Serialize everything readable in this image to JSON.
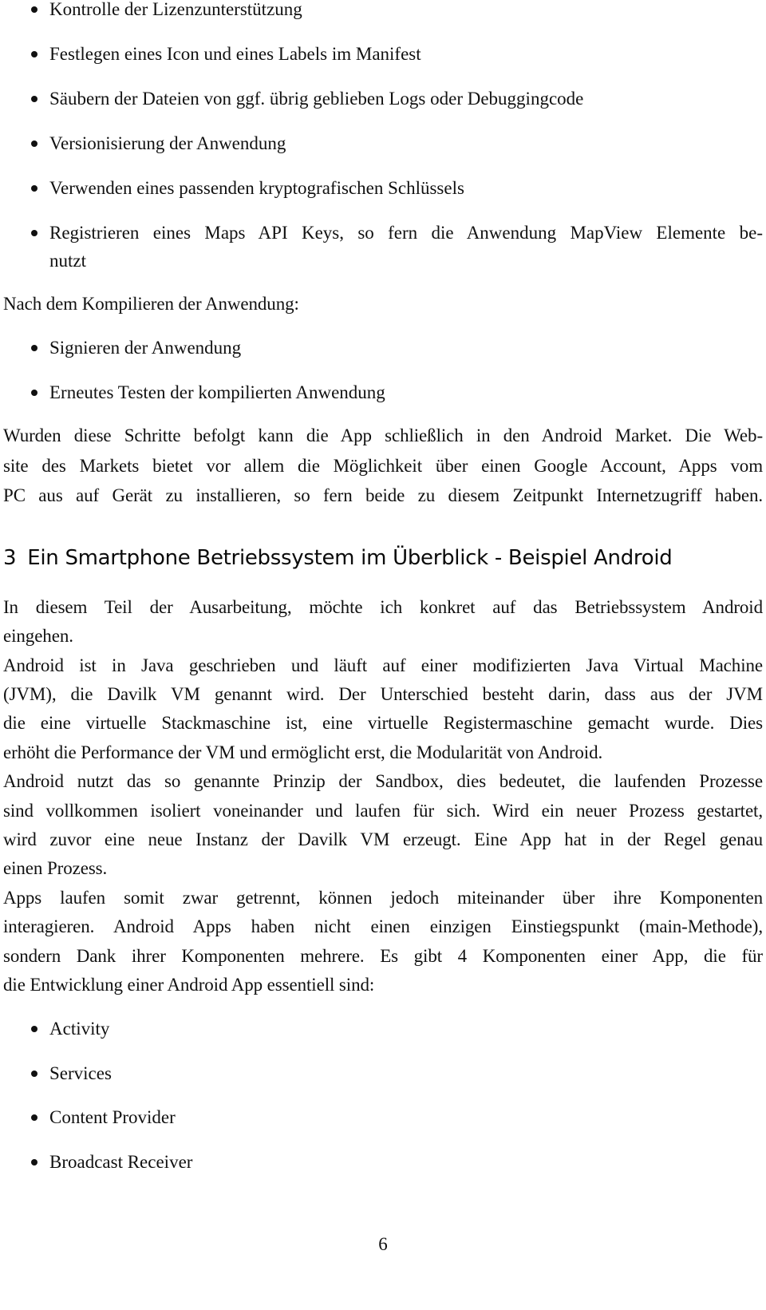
{
  "list_before_compile": [
    "Kontrolle der Lizenzunterstützung",
    "Festlegen eines Icon und eines Labels im Manifest",
    "Säubern der Dateien von ggf. übrig geblieben Logs oder Debuggingcode",
    "Versionisierung der Anwendung",
    "Verwenden eines passenden kryptografischen Schlüssels",
    {
      "line1": "Registrieren eines Maps API Keys, so fern die Anwendung MapView Elemente be-",
      "line2": "nutzt"
    }
  ],
  "after_compile_intro": "Nach dem Kompilieren der Anwendung:",
  "list_after_compile": [
    "Signieren der Anwendung",
    "Erneutes Testen der kompilierten Anwendung"
  ],
  "market_paragraph": [
    "Wurden diese Schritte befolgt kann die App schließlich in den Android Market. Die Web-",
    "site des Markets bietet vor allem die Möglichkeit über einen Google Account, Apps vom",
    "PC aus auf Gerät zu installieren, so fern beide zu diesem Zeitpunkt Internetzugriff haben."
  ],
  "section": {
    "number": "3",
    "title": "Ein Smartphone Betriebssystem im Überblick - Beispiel Android"
  },
  "section_body": [
    {
      "text": "In diesem Teil der Ausarbeitung, möchte ich konkret auf das Betriebssystem Android",
      "justify": true
    },
    {
      "text": "eingehen.",
      "justify": false
    },
    {
      "text": "Android ist in Java geschrieben und läuft auf einer modifizierten Java Virtual Machine",
      "justify": true
    },
    {
      "text": "(JVM), die Davilk VM genannt wird. Der Unterschied besteht darin, dass aus der JVM",
      "justify": true
    },
    {
      "text": "die eine virtuelle Stackmaschine ist, eine virtuelle Registermaschine gemacht wurde. Dies",
      "justify": true
    },
    {
      "text": "erhöht die Performance der VM und ermöglicht erst, die Modularität von Android.",
      "justify": false
    },
    {
      "text": "Android nutzt das so genannte Prinzip der Sandbox, dies bedeutet, die laufenden Prozesse",
      "justify": true
    },
    {
      "text": "sind vollkommen isoliert voneinander und laufen für sich. Wird ein neuer Prozess gestartet,",
      "justify": true
    },
    {
      "text": "wird zuvor eine neue Instanz der Davilk VM erzeugt. Eine App hat in der Regel genau",
      "justify": true
    },
    {
      "text": "einen Prozess.",
      "justify": false
    },
    {
      "text": "Apps laufen somit zwar getrennt, können jedoch miteinander über ihre Komponenten",
      "justify": true
    },
    {
      "text": "interagieren. Android Apps haben nicht einen einzigen Einstiegspunkt (main-Methode),",
      "justify": true
    },
    {
      "text": "sondern Dank ihrer Komponenten mehrere. Es gibt 4 Komponenten einer App, die für",
      "justify": true
    },
    {
      "text": "die Entwicklung einer Android App essentiell sind:",
      "justify": false
    }
  ],
  "components": [
    "Activity",
    "Services",
    "Content Provider",
    "Broadcast Receiver"
  ],
  "page_number": "6"
}
